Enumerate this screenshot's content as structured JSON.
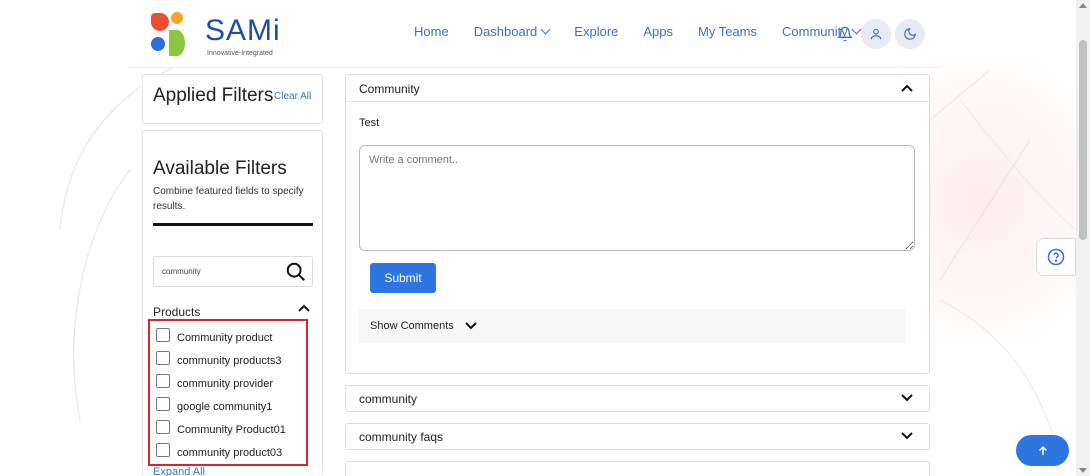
{
  "brand": {
    "name": "SAMi",
    "tagline": "Innovative-Integrated"
  },
  "nav": {
    "items": [
      {
        "label": "Home",
        "dropdown": false
      },
      {
        "label": "Dashboard",
        "dropdown": true
      },
      {
        "label": "Explore",
        "dropdown": false
      },
      {
        "label": "Apps",
        "dropdown": false
      },
      {
        "label": "My Teams",
        "dropdown": false
      },
      {
        "label": "Community",
        "dropdown": true
      }
    ],
    "icons": [
      "bell-icon",
      "user-icon",
      "moon-icon"
    ]
  },
  "applied_filters": {
    "title": "Applied Filters",
    "clear_label": "Clear All"
  },
  "available_filters": {
    "title": "Available Filters",
    "description": "Combine featured fields to specify results.",
    "search_value": "community",
    "products_label": "Products",
    "products": [
      "Community product",
      "community products3",
      "community provider",
      "google community1",
      "Community Product01",
      "community product03"
    ],
    "expand_label": "Expand All"
  },
  "main_card": {
    "title": "Community",
    "post_text": "Test",
    "comment_placeholder": "Write a comment..",
    "submit_label": "Submit",
    "show_comments_label": "Show Comments"
  },
  "cards": [
    {
      "title": "community"
    },
    {
      "title": "community faqs"
    }
  ],
  "colors": {
    "accent": "#2f75e0",
    "link": "#3b73c4",
    "highlight_border": "#d9262c"
  }
}
